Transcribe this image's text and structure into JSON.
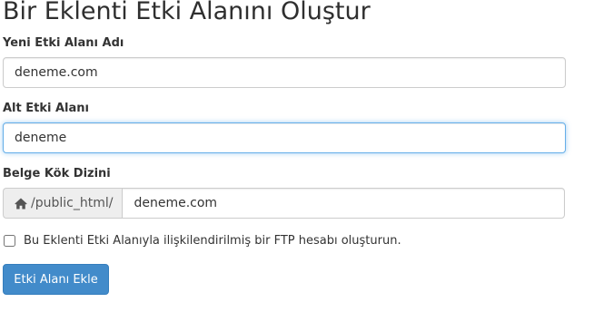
{
  "page": {
    "title": "Bir Eklenti Etki Alanını Oluştur"
  },
  "form": {
    "new_domain": {
      "label": "Yeni Etki Alanı Adı",
      "value": "deneme.com"
    },
    "subdomain": {
      "label": "Alt Etki Alanı",
      "value": "deneme"
    },
    "document_root": {
      "label": "Belge Kök Dizini",
      "prefix": "/public_html/",
      "prefix_icon": "home-icon",
      "value": "deneme.com"
    },
    "ftp_checkbox": {
      "label": "Bu Eklenti Etki Alanıyla ilişkilendirilmiş bir FTP hesabı oluşturun.",
      "checked": false
    },
    "submit_label": "Etki Alanı Ekle"
  },
  "colors": {
    "primary": "#428bca",
    "focus": "#66afe9"
  }
}
